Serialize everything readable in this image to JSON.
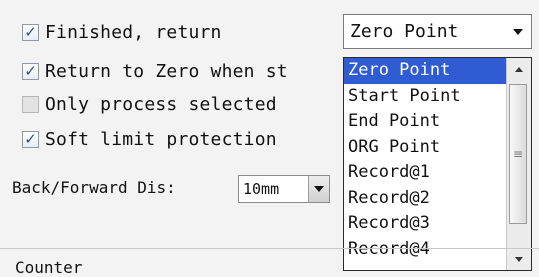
{
  "options": [
    {
      "label": "Finished, return",
      "checked": true
    },
    {
      "label": "Return to Zero when st",
      "checked": true
    },
    {
      "label": "Only process selected",
      "checked": false
    },
    {
      "label": "Soft limit protection",
      "checked": true
    }
  ],
  "back_forward": {
    "label": "Back/Forward Dis:",
    "value": "10mm"
  },
  "return_target": {
    "value": "Zero Point",
    "items": [
      "Zero Point",
      "Start Point",
      "End Point",
      "ORG Point",
      "Record@1",
      "Record@2",
      "Record@3",
      "Record@4"
    ],
    "selected_index": 0
  },
  "section": {
    "counter": "Counter"
  },
  "icons": {
    "check": "checkmark-icon",
    "dropdown": "chevron-down-icon",
    "scroll_up": "arrow-up-icon",
    "scroll_down": "arrow-down-icon"
  },
  "colors": {
    "selection": "#2f5bd3",
    "check": "#2c4d9b"
  }
}
